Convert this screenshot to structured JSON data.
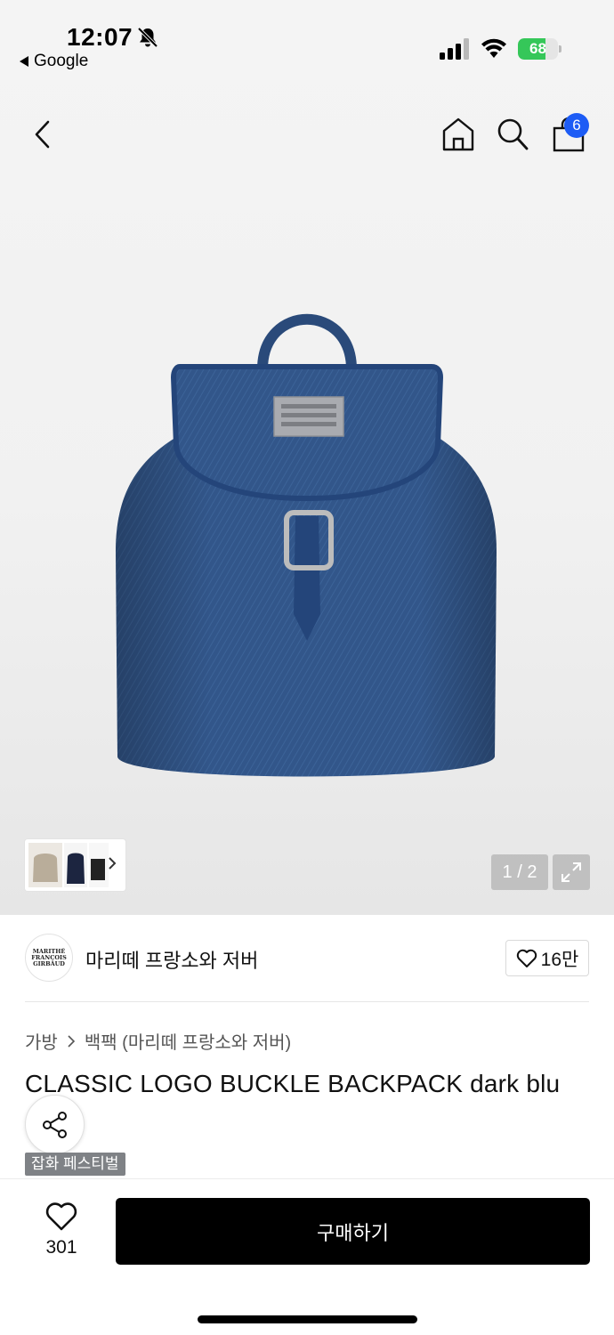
{
  "status_bar": {
    "time": "12:07",
    "back_app": "Google",
    "battery": "68",
    "battery_level": 0.68,
    "icons": [
      "bell-slash-icon",
      "cellular-signal-icon",
      "wifi-icon",
      "battery-charging-icon"
    ]
  },
  "nav": {
    "cart_count": "6",
    "icons": [
      "back-chevron-icon",
      "home-icon",
      "search-icon",
      "shopping-bag-icon"
    ]
  },
  "gallery": {
    "pager": "1 / 2",
    "icons": [
      "expand-icon",
      "chevron-right-icon"
    ]
  },
  "brand": {
    "logo_lines": [
      "MARITHÉ",
      "FRANÇOIS",
      "GIRBAUD"
    ],
    "name": "마리떼 프랑소와 저버",
    "likes": "16만"
  },
  "breadcrumb": {
    "category": "가방",
    "subcategory": "백팩 (마리떼 프랑소와 저버)"
  },
  "product": {
    "title": "CLASSIC LOGO BUCKLE BACKPACK dark blu",
    "tag": "잡화 페스티벌"
  },
  "bottom_bar": {
    "wish_count": "301",
    "buy_label": "구매하기"
  },
  "colors": {
    "accent_badge": "#1d5cf5",
    "buy_button": "#000000",
    "battery_green": "#35c759",
    "tag_bg": "#7f8286"
  }
}
